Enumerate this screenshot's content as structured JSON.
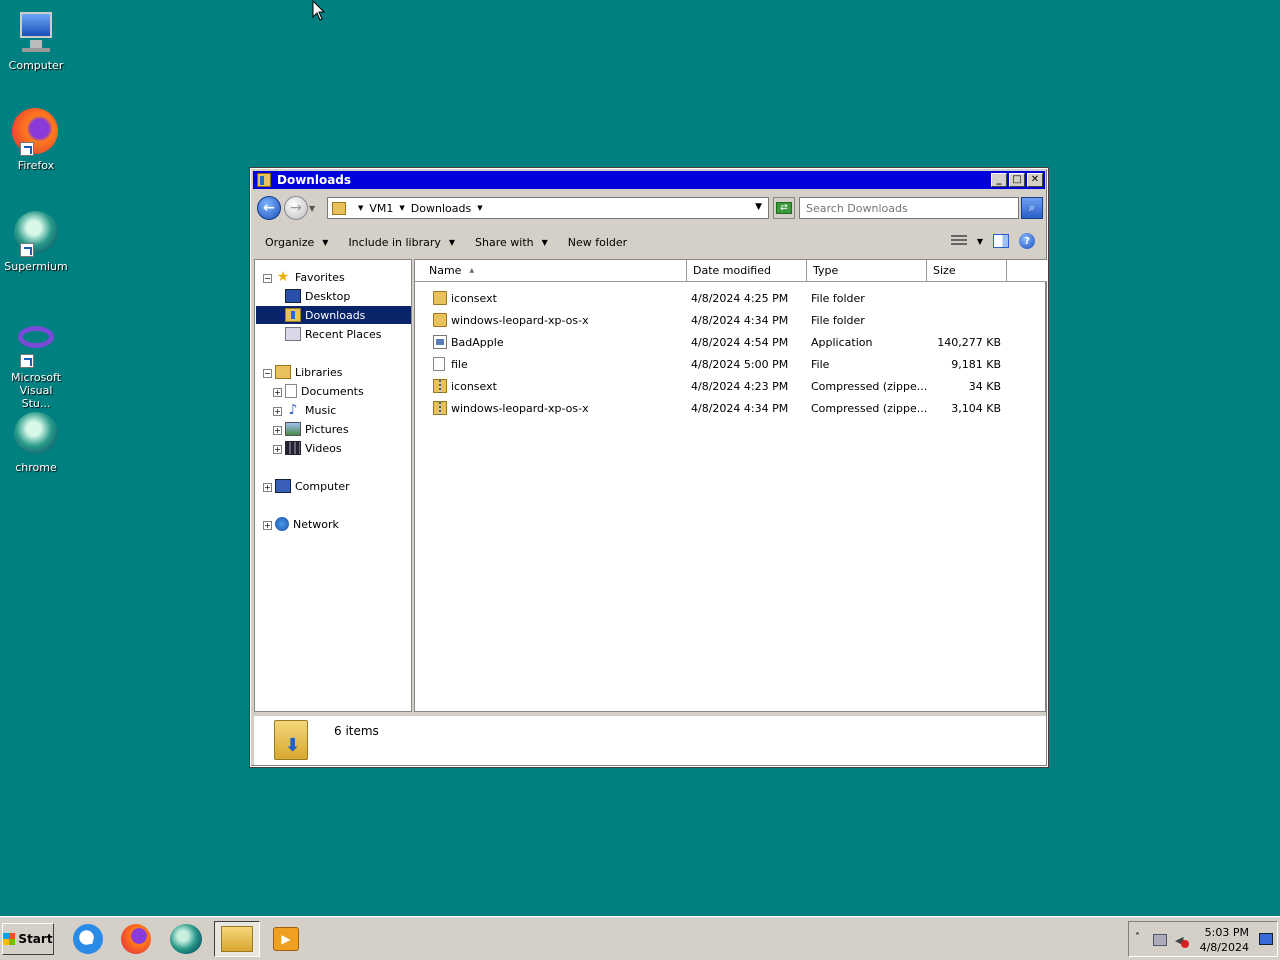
{
  "desktop": {
    "icons": [
      {
        "label": "Computer"
      },
      {
        "label": "Firefox"
      },
      {
        "label": "Supermium"
      },
      {
        "label": "Microsoft\nVisual Stu..."
      },
      {
        "label": "chrome"
      }
    ]
  },
  "window": {
    "title": "Downloads",
    "breadcrumb": [
      "VM1",
      "Downloads"
    ],
    "search_placeholder": "Search Downloads",
    "toolbar": {
      "organize": "Organize",
      "include_in_library": "Include in library",
      "share_with": "Share with",
      "new_folder": "New folder"
    },
    "nav": {
      "favorites": "Favorites",
      "desktop": "Desktop",
      "downloads": "Downloads",
      "recent_places": "Recent Places",
      "libraries": "Libraries",
      "documents": "Documents",
      "music": "Music",
      "pictures": "Pictures",
      "videos": "Videos",
      "computer": "Computer",
      "network": "Network"
    },
    "columns": {
      "name": "Name",
      "date_modified": "Date modified",
      "type": "Type",
      "size": "Size"
    },
    "files": [
      {
        "name": "iconsext",
        "date": "4/8/2024 4:25 PM",
        "type": "File folder",
        "size": ""
      },
      {
        "name": "windows-leopard-xp-os-x",
        "date": "4/8/2024 4:34 PM",
        "type": "File folder",
        "size": ""
      },
      {
        "name": "BadApple",
        "date": "4/8/2024 4:54 PM",
        "type": "Application",
        "size": "140,277 KB"
      },
      {
        "name": "file",
        "date": "4/8/2024 5:00 PM",
        "type": "File",
        "size": "9,181 KB"
      },
      {
        "name": "iconsext",
        "date": "4/8/2024 4:23 PM",
        "type": "Compressed (zippe...",
        "size": "34 KB"
      },
      {
        "name": "windows-leopard-xp-os-x",
        "date": "4/8/2024 4:34 PM",
        "type": "Compressed (zippe...",
        "size": "3,104 KB"
      }
    ],
    "status": "6 items"
  },
  "taskbar": {
    "start_label": "Start",
    "clock_time": "5:03 PM",
    "clock_date": "4/8/2024"
  }
}
